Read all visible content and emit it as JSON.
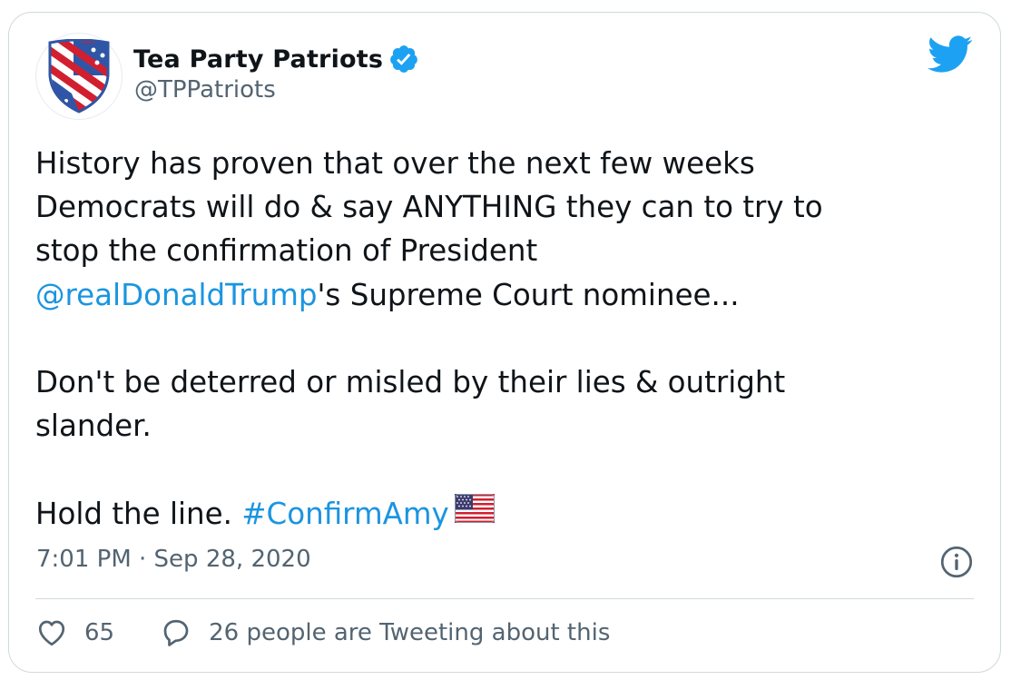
{
  "author": {
    "display_name": "Tea Party Patriots",
    "handle": "@TPPatriots",
    "verified": true,
    "avatar_icon": "shield-flag-logo-icon"
  },
  "tweet": {
    "line_1": "History has proven that over the next few weeks",
    "line_2": "Democrats will do & say ANYTHING they can to try to",
    "line_3": "stop the confirmation of President",
    "mention": "@realDonaldTrump",
    "line_4_rest": "'s Supreme Court nominee...",
    "paragraph_2": "Don't be deterred or misled by their lies & outright\nslander.",
    "paragraph_3_start": "Hold the line. ",
    "hashtag": "#ConfirmAmy",
    "emoji": "us-flag-emoji"
  },
  "timestamp": "7:01 PM · Sep 28, 2020",
  "stats": {
    "likes": "65",
    "retweeting_text": "26 people are Tweeting about this"
  },
  "colors": {
    "link": "#1b95e0",
    "text": "#0f1419",
    "muted": "#536471",
    "border": "#cfd9de",
    "twitter_blue": "#1da1f2"
  }
}
